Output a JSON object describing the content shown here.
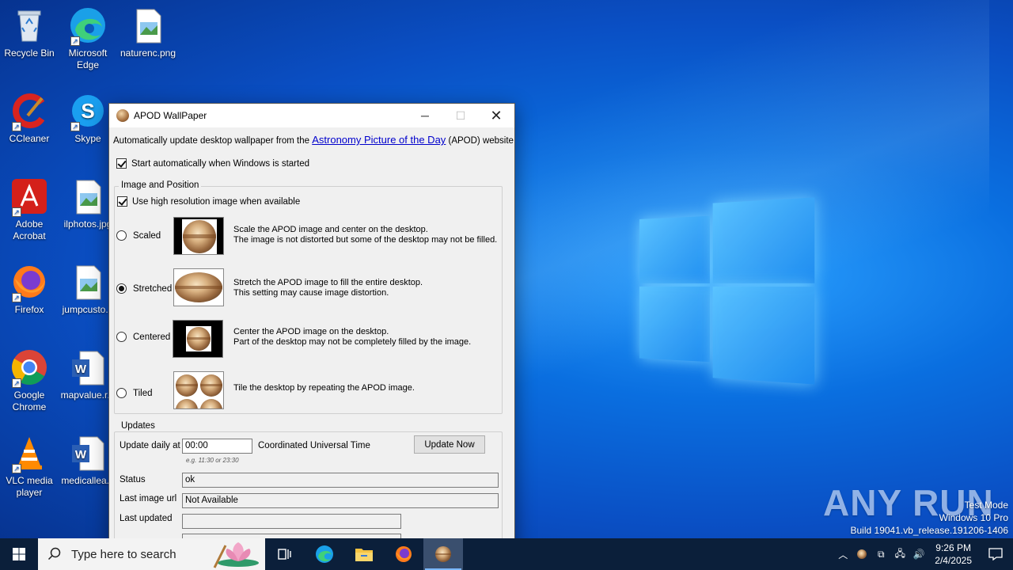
{
  "desktop": {
    "icons": [
      {
        "label": "Recycle Bin"
      },
      {
        "label": "Microsoft Edge"
      },
      {
        "label": "naturenc.png"
      },
      {
        "label": "CCleaner"
      },
      {
        "label": "Skype"
      },
      {
        "label": "Adobe Acrobat"
      },
      {
        "label": "ilphotos.jpg"
      },
      {
        "label": "Firefox"
      },
      {
        "label": "jumpcusto..."
      },
      {
        "label": "Google Chrome"
      },
      {
        "label": "mapvalue.r..."
      },
      {
        "label": "VLC media player"
      },
      {
        "label": "medicallea..."
      }
    ]
  },
  "window": {
    "title": "APOD WallPaper",
    "description_prefix": "Automatically update desktop wallpaper from the",
    "description_link": "Astronomy Picture of the Day",
    "description_suffix": "(APOD) website.",
    "start_auto_label": "Start automatically when Windows is started",
    "start_auto_checked": true,
    "image_group_label": "Image and Position",
    "high_res_label": "Use high resolution image when available",
    "high_res_checked": true,
    "options": [
      {
        "label": "Scaled",
        "selected": false,
        "desc1": "Scale the APOD image and center on the desktop.",
        "desc2": "The image is not distorted but some of the desktop may not be filled."
      },
      {
        "label": "Stretched",
        "selected": true,
        "desc1": "Stretch the APOD image to fill the entire desktop.",
        "desc2": "This setting may cause image distortion."
      },
      {
        "label": "Centered",
        "selected": false,
        "desc1": "Center the APOD image on the desktop.",
        "desc2": "Part of the desktop may not be completely filled by the image."
      },
      {
        "label": "Tiled",
        "selected": false,
        "desc1": "Tile the desktop by repeating the APOD image.",
        "desc2": ""
      }
    ],
    "updates_group_label": "Updates",
    "update_daily_label": "Update daily at",
    "update_time": "00:00",
    "timezone_label": "Coordinated Universal Time",
    "time_hint": "e.g. 11:30 or 23:30",
    "update_now_label": "Update Now",
    "status_label": "Status",
    "status_value": "ok",
    "last_url_label": "Last image url",
    "last_url_value": "Not Available",
    "last_updated_label": "Last updated",
    "last_updated_value": ""
  },
  "watermark": {
    "brand": "ANY RUN",
    "test_mode": "Test Mode",
    "edition": "Windows 10 Pro",
    "build": "Build 19041.vb_release.191206-1406"
  },
  "taskbar": {
    "search_placeholder": "Type here to search",
    "time": "9:26 PM",
    "date": "2/4/2025"
  }
}
